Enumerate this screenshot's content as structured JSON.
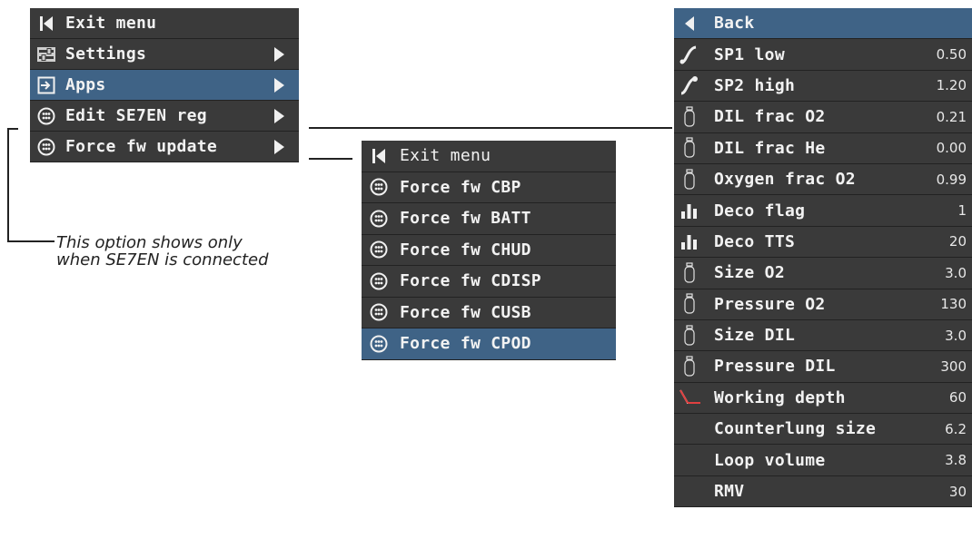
{
  "main_menu": {
    "items": [
      {
        "label": "Exit menu",
        "icon": "exit-icon",
        "submenu": false,
        "selected": false
      },
      {
        "label": "Settings",
        "icon": "settings-icon",
        "submenu": true,
        "selected": false
      },
      {
        "label": "Apps",
        "icon": "apps-icon",
        "submenu": true,
        "selected": true
      },
      {
        "label": "Edit SE7EN reg",
        "icon": "dots-icon",
        "submenu": true,
        "selected": false
      },
      {
        "label": "Force fw update",
        "icon": "dots-icon",
        "submenu": true,
        "selected": false
      }
    ]
  },
  "note": {
    "line1": "This option shows only",
    "line2": "when SE7EN is connected"
  },
  "force_menu": {
    "items": [
      {
        "label": "Exit menu",
        "icon": "exit-icon",
        "selected": false
      },
      {
        "label": "Force fw CBP",
        "icon": "dots-icon",
        "selected": false
      },
      {
        "label": "Force fw BATT",
        "icon": "dots-icon",
        "selected": false
      },
      {
        "label": "Force fw CHUD",
        "icon": "dots-icon",
        "selected": false
      },
      {
        "label": "Force fw CDISP",
        "icon": "dots-icon",
        "selected": false
      },
      {
        "label": "Force fw CUSB",
        "icon": "dots-icon",
        "selected": false
      },
      {
        "label": "Force fw CPOD",
        "icon": "dots-icon",
        "selected": true
      }
    ]
  },
  "reg_menu": {
    "items": [
      {
        "label": "Back",
        "value": "",
        "icon": "back-icon",
        "selected": true
      },
      {
        "label": "SP1 low",
        "value": "0.50",
        "icon": "setpoint-low-icon",
        "selected": false
      },
      {
        "label": "SP2 high",
        "value": "1.20",
        "icon": "setpoint-high-icon",
        "selected": false
      },
      {
        "label": "DIL frac O2",
        "value": "0.21",
        "icon": "cylinder-icon",
        "selected": false
      },
      {
        "label": "DIL frac He",
        "value": "0.00",
        "icon": "cylinder-icon",
        "selected": false
      },
      {
        "label": "Oxygen frac O2",
        "value": "0.99",
        "icon": "cylinder-icon",
        "selected": false
      },
      {
        "label": "Deco flag",
        "value": "1",
        "icon": "bar-chart-icon",
        "selected": false
      },
      {
        "label": "Deco TTS",
        "value": "20",
        "icon": "bar-chart-icon",
        "selected": false
      },
      {
        "label": "Size O2",
        "value": "3.0",
        "icon": "cylinder-icon",
        "selected": false
      },
      {
        "label": "Pressure O2",
        "value": "130",
        "icon": "cylinder-icon",
        "selected": false
      },
      {
        "label": "Size DIL",
        "value": "3.0",
        "icon": "cylinder-icon",
        "selected": false
      },
      {
        "label": "Pressure DIL",
        "value": "300",
        "icon": "cylinder-icon",
        "selected": false
      },
      {
        "label": "Working depth",
        "value": "60",
        "icon": "depth-icon",
        "selected": false
      },
      {
        "label": "Counterlung size",
        "value": "6.2",
        "icon": "",
        "selected": false
      },
      {
        "label": "Loop volume",
        "value": "3.8",
        "icon": "",
        "selected": false
      },
      {
        "label": "RMV",
        "value": "30",
        "icon": "",
        "selected": false
      }
    ]
  },
  "colors": {
    "menu_bg": "#3a3a3a",
    "selected_bg": "#3f6386",
    "text": "#f2f2f2",
    "accent_red": "#e04040"
  }
}
